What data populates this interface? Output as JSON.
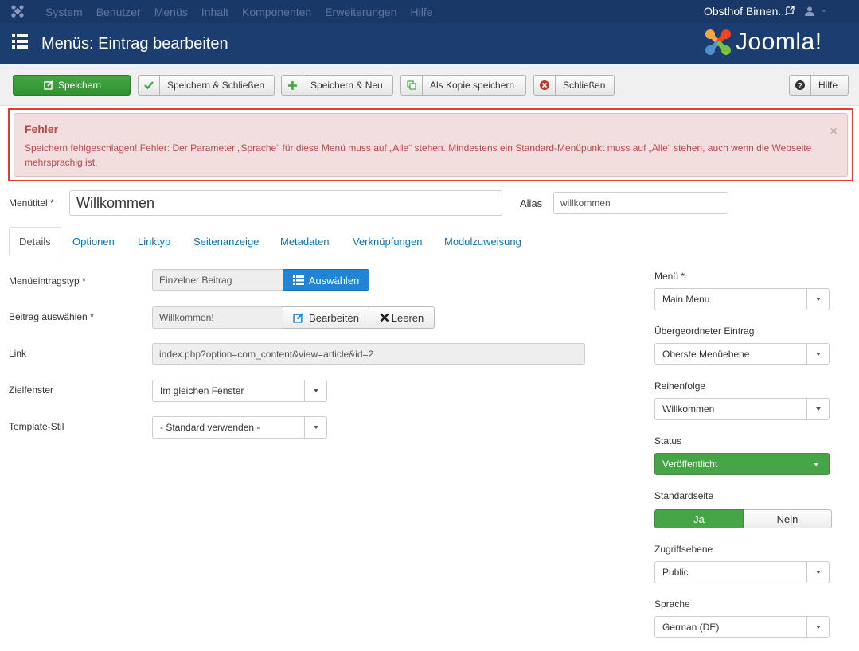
{
  "topbar": {
    "menu": [
      "System",
      "Benutzer",
      "Menüs",
      "Inhalt",
      "Komponenten",
      "Erweiterungen",
      "Hilfe"
    ],
    "site_name": "Obsthof Birnen..."
  },
  "header": {
    "title": "Menüs: Eintrag bearbeiten",
    "brand": "Joomla!"
  },
  "toolbar": {
    "save": "Speichern",
    "save_close": "Speichern & Schließen",
    "save_new": "Speichern & Neu",
    "save_copy": "Als Kopie speichern",
    "close": "Schließen",
    "help": "Hilfe"
  },
  "alert": {
    "heading": "Fehler",
    "message": "Speichern fehlgeschlagen! Fehler: Der Parameter „Sprache“ für diese Menü muss auf „Alle“ stehen. Mindestens ein Standard-Menüpunkt muss auf „Alle“ stehen, auch wenn die Webseite mehrsprachig ist.",
    "close": "×"
  },
  "title_fields": {
    "title_label": "Menütitel *",
    "title_value": "Willkommen",
    "alias_label": "Alias",
    "alias_value": "willkommen"
  },
  "tabs": [
    "Details",
    "Optionen",
    "Linktyp",
    "Seitenanzeige",
    "Metadaten",
    "Verknüpfungen",
    "Modulzuweisung"
  ],
  "details": {
    "type_label": "Menüeintragstyp *",
    "type_value": "Einzelner Beitrag",
    "type_button": "Auswählen",
    "article_label": "Beitrag auswählen *",
    "article_value": "Willkommen!",
    "edit_button": "Bearbeiten",
    "clear_button": "Leeren",
    "link_label": "Link",
    "link_value": "index.php?option=com_content&view=article&id=2",
    "target_label": "Zielfenster",
    "target_value": "Im gleichen Fenster",
    "template_label": "Template-Stil",
    "template_value": "- Standard verwenden -"
  },
  "sidebar": {
    "menu_label": "Menü *",
    "menu_value": "Main Menu",
    "parent_label": "Übergeordneter Eintrag",
    "parent_value": "Oberste Menüebene",
    "order_label": "Reihenfolge",
    "order_value": "Willkommen",
    "status_label": "Status",
    "status_value": "Veröffentlicht",
    "default_label": "Standardseite",
    "default_yes": "Ja",
    "default_no": "Nein",
    "access_label": "Zugriffsebene",
    "access_value": "Public",
    "language_label": "Sprache",
    "language_value": "German (DE)"
  },
  "colors": {
    "topbar": "#1a3867",
    "titlebar": "#1c3d6f",
    "success": "#46a546",
    "primary": "#2384d3",
    "alert_bg": "#f2dede",
    "alert_text": "#b94a48",
    "highlight": "#e53a2f"
  }
}
